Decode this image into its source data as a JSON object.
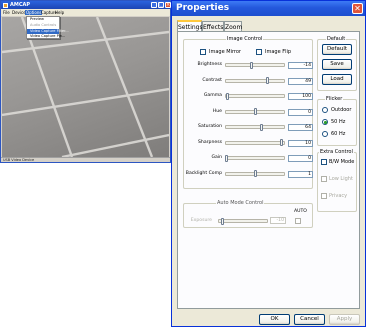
{
  "capture_window": {
    "title": "AMCAP",
    "menu": [
      "File",
      "Devices",
      "Options",
      "Capture",
      "Help"
    ],
    "options_menu": [
      "Preview",
      "Audio Controls",
      "Video Capture Filter...",
      "Video Capture Pin..."
    ],
    "status": "USB Video Device"
  },
  "dialog": {
    "title": "Properties",
    "tabs": [
      "Settings",
      "Effects",
      "Zoom"
    ],
    "image_control": {
      "label": "Image Control",
      "mirror_label": "Image Mirror",
      "flip_label": "Image Flip",
      "sliders": [
        {
          "label": "Brightness",
          "value": "-14",
          "pos": 0.43
        },
        {
          "label": "Contrast",
          "value": "49",
          "pos": 0.72
        },
        {
          "label": "Gamma",
          "value": "100",
          "pos": 0.02
        },
        {
          "label": "Hue",
          "value": "0",
          "pos": 0.5
        },
        {
          "label": "Saturation",
          "value": "64",
          "pos": 0.62
        },
        {
          "label": "Sharpness",
          "value": "10",
          "pos": 0.97
        },
        {
          "label": "Gain",
          "value": "0",
          "pos": 0.0
        },
        {
          "label": "Backlight Comp",
          "value": "1",
          "pos": 0.5
        }
      ]
    },
    "default_group": {
      "label": "Default",
      "buttons": [
        "Default",
        "Save",
        "Load"
      ]
    },
    "flicker": {
      "label": "Flicker",
      "options": [
        {
          "label": "Outdoor",
          "selected": false
        },
        {
          "label": "50 Hz",
          "selected": true
        },
        {
          "label": "60 Hz",
          "selected": false
        }
      ]
    },
    "extra_control": {
      "label": "Extra Control",
      "options": [
        {
          "label": "B/W Mode",
          "enabled": true
        },
        {
          "label": "Low Light",
          "enabled": false
        },
        {
          "label": "Privacy",
          "enabled": false
        }
      ]
    },
    "auto_mode": {
      "label": "Auto Mode Control",
      "auto_label": "AUTO",
      "exposure_label": "Exposure",
      "exposure_value": "-10"
    },
    "buttons": {
      "ok": "OK",
      "cancel": "Cancel",
      "apply": "Apply"
    }
  },
  "colors": {
    "titlebar": "#2458dc",
    "dialog_bg": "#ece9d8",
    "close": "#e0553a"
  }
}
